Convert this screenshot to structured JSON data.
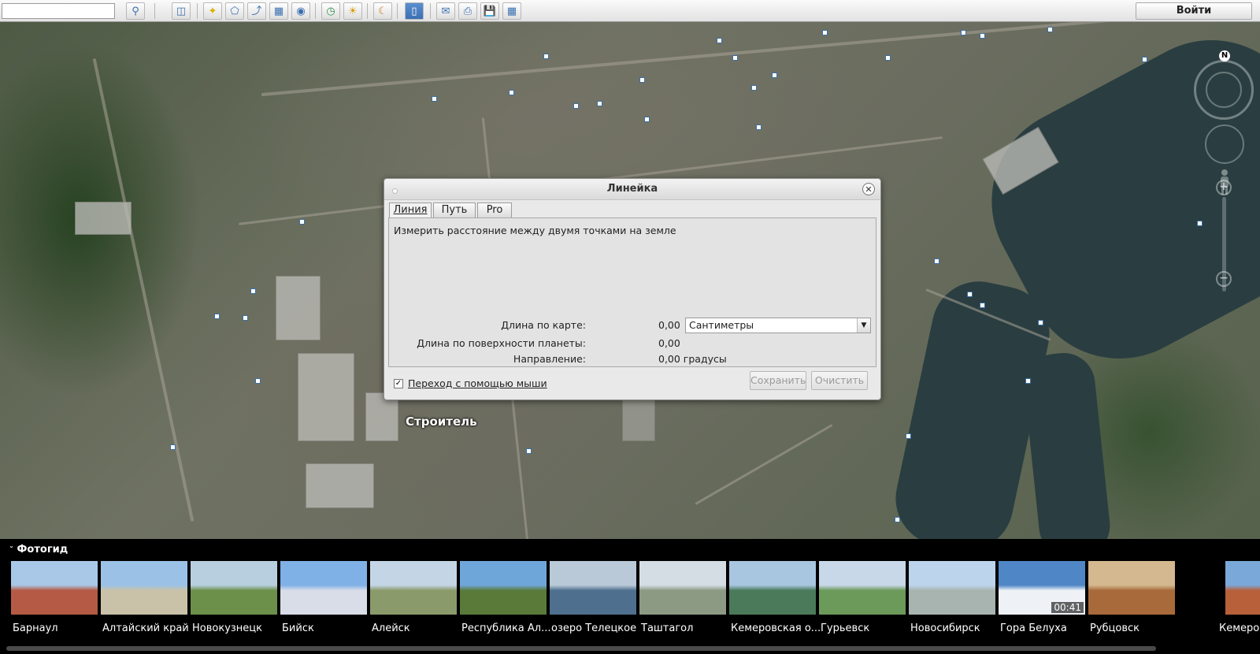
{
  "toolbar": {
    "search_value": "",
    "buttons": [
      "search-icon",
      "sidebar-icon",
      "placemark-icon",
      "polygon-icon",
      "path-icon",
      "overlay-icon",
      "tour-icon",
      "historical-imagery-icon",
      "sun-icon",
      "planets-icon",
      "ruler-icon",
      "email-icon",
      "print-icon",
      "save-image-icon",
      "view-maps-icon"
    ],
    "login_label": "Войти"
  },
  "map": {
    "place_label": "Строитель",
    "north_label": "N"
  },
  "ruler_dialog": {
    "title": "Линейка",
    "close_glyph": "✕",
    "tabs": [
      "Линия",
      "Путь",
      "Pro"
    ],
    "description": "Измерить расстояние между двумя точками на земле",
    "map_length_label": "Длина по карте:",
    "map_length_value": "0,00",
    "unit_selected": "Сантиметры",
    "ground_length_label": "Длина по поверхности планеты:",
    "ground_length_value": "0,00",
    "heading_label": "Направление:",
    "heading_value": "0,00 градусы",
    "mouse_nav_checked": true,
    "mouse_nav_label": "Переход с помощью мыши",
    "save_label": "Сохранить",
    "clear_label": "Очистить"
  },
  "photoguide": {
    "header": "Фотогид",
    "items": [
      {
        "label": "Барнаул",
        "colors": [
          "#a9c8e8",
          "#b55a44"
        ]
      },
      {
        "label": "Алтайский край",
        "colors": [
          "#9cc1e6",
          "#c9c2a8"
        ]
      },
      {
        "label": "Новокузнецк",
        "colors": [
          "#b8cfe0",
          "#6c8f4a"
        ]
      },
      {
        "label": "Бийск",
        "colors": [
          "#7fb0e6",
          "#d8dde8"
        ]
      },
      {
        "label": "Алейск",
        "colors": [
          "#c4d6e6",
          "#8a9a6a"
        ]
      },
      {
        "label": "Республика Ал...",
        "colors": [
          "#6fa6da",
          "#5a7a3a"
        ]
      },
      {
        "label": "озеро Телецкое",
        "colors": [
          "#b9c9d8",
          "#4f6f8f"
        ]
      },
      {
        "label": "Таштагол",
        "colors": [
          "#d4dce4",
          "#8c9a84"
        ]
      },
      {
        "label": "Кемеровская о...",
        "colors": [
          "#a8c6e0",
          "#4a7a5a"
        ]
      },
      {
        "label": "Гурьевск",
        "colors": [
          "#c8d8e8",
          "#6c9a5a"
        ]
      },
      {
        "label": "Новосибирск",
        "colors": [
          "#bcd4ec",
          "#a8b4b0"
        ]
      },
      {
        "label": "Гора Белуха",
        "colors": [
          "#4f86c6",
          "#eef2f6"
        ],
        "duration": "00:41"
      },
      {
        "label": "Рубцовск",
        "colors": [
          "#d4b890",
          "#a86a3a"
        ]
      },
      {
        "label": "Кемерово",
        "colors": [
          "#7aa8d8",
          "#b8603a"
        ]
      }
    ]
  }
}
